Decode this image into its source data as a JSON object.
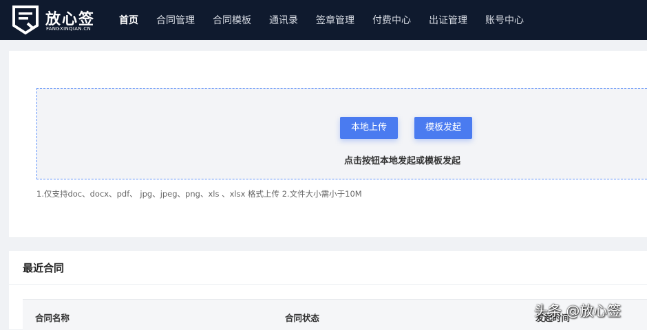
{
  "header": {
    "logo_title": "放心签",
    "logo_subtitle": "FANGXINQIAN.CN",
    "nav": [
      {
        "label": "首页",
        "active": true
      },
      {
        "label": "合同管理"
      },
      {
        "label": "合同模板"
      },
      {
        "label": "通讯录"
      },
      {
        "label": "签章管理"
      },
      {
        "label": "付费中心"
      },
      {
        "label": "出证管理"
      },
      {
        "label": "账号中心"
      }
    ]
  },
  "upload": {
    "local_button": "本地上传",
    "template_button": "模板发起",
    "hint": "点击按钮本地发起或模板发起",
    "note": "1.仅支持doc、docx、pdf、 jpg、jpeg、png、xls 、xlsx 格式上传 2.文件大小需小于10M"
  },
  "recent": {
    "title": "最近合同",
    "columns": [
      "合同名称",
      "合同状态",
      "发起时间"
    ]
  },
  "watermark": "头条 @放心签",
  "colors": {
    "topbar": "#0f1a2e",
    "primary": "#4a7bf0",
    "dropzone_border": "#5b8ff9"
  }
}
